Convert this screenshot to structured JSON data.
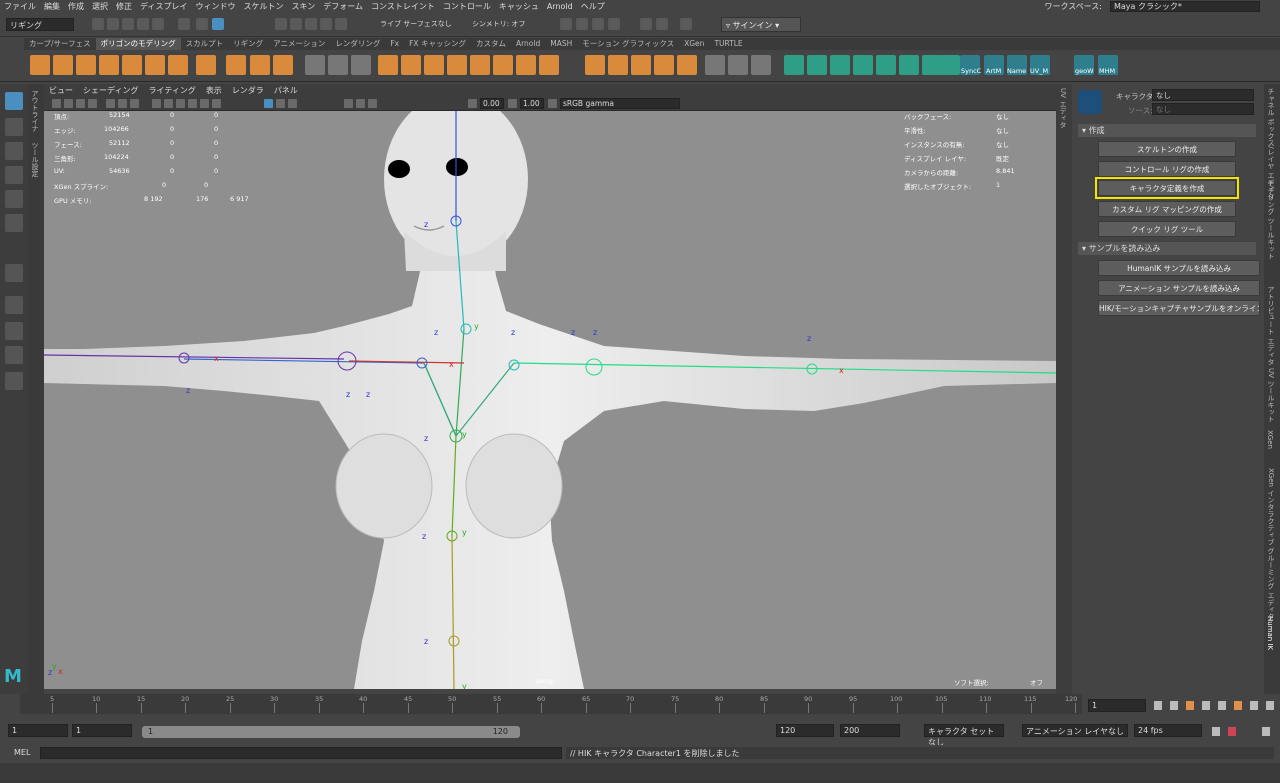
{
  "menubar": {
    "items": [
      "ファイル",
      "編集",
      "作成",
      "選択",
      "修正",
      "ディスプレイ",
      "ウィンドウ",
      "スケルトン",
      "スキン",
      "デフォーム",
      "コンストレイント",
      "コントロール",
      "キャッシュ",
      "Arnold",
      "ヘルプ"
    ],
    "workspace_label": "ワークスペース:",
    "workspace_value": "Maya クラシック*"
  },
  "statusline": {
    "mode": "リギング",
    "live_surface": "ライブ サーフェスなし",
    "symmetry": "シンメトリ: オフ",
    "signin": "サインイン"
  },
  "shelf": {
    "tabs": [
      "カーブ/サーフェス",
      "ポリゴンのモデリング",
      "スカルプト",
      "リギング",
      "アニメーション",
      "レンダリング",
      "Fx",
      "FX キャッシング",
      "カスタム",
      "Arnold",
      "MASH",
      "モーション グラフィックス",
      "XGen",
      "TURTLE"
    ],
    "active_tab": "ポリゴンのモデリング",
    "labels": [
      "SyncC",
      "ArtM",
      "Name",
      "UV_M",
      "geoW",
      "MHM"
    ]
  },
  "sidetabs_left": [
    "アウトライナ",
    "ツール設定"
  ],
  "panel": {
    "menu": [
      "ビュー",
      "シェーディング",
      "ライティング",
      "表示",
      "レンダラ",
      "パネル"
    ],
    "exposure": "0.00",
    "gamma": "1.00",
    "color_space": "sRGB gamma"
  },
  "hud_left": [
    {
      "label": "頂点:",
      "v1": "52154",
      "v2": "0",
      "v3": "0"
    },
    {
      "label": "エッジ:",
      "v1": "104266",
      "v2": "0",
      "v3": "0"
    },
    {
      "label": "フェース:",
      "v1": "52112",
      "v2": "0",
      "v3": "0"
    },
    {
      "label": "三角形:",
      "v1": "104224",
      "v2": "0",
      "v3": "0"
    },
    {
      "label": "UV:",
      "v1": "54636",
      "v2": "0",
      "v3": "0"
    },
    {
      "label": "XGen スプライン:",
      "v1": "",
      "v2": "0",
      "v3": "0"
    },
    {
      "label": "GPU メモリ:",
      "v1": "8 192",
      "v2": "176",
      "v3": "6 917"
    }
  ],
  "hud_right": [
    {
      "label": "バックフェース:",
      "value": "なし"
    },
    {
      "label": "平滑性:",
      "value": "なし"
    },
    {
      "label": "インスタンスの有無:",
      "value": "なし"
    },
    {
      "label": "ディスプレイ レイヤ:",
      "value": "既定"
    },
    {
      "label": "カメラからの距離:",
      "value": "8.841"
    },
    {
      "label": "選択したオブジェクト:",
      "value": "1"
    }
  ],
  "viewport": {
    "camera": "persp",
    "soft_select_label": "ソフト選択:",
    "soft_select_value": "オフ"
  },
  "uv_strip_label": "UV エディタ",
  "hik": {
    "character_label": "キャラクタ:",
    "character_value": "なし",
    "source_label": "ソース:",
    "source_value": "なし",
    "section_create": "作成",
    "buttons_create": [
      "スケルトンの作成",
      "コントロール リグの作成",
      "キャラクタ定義を作成",
      "カスタム リグ マッピングの作成",
      "クイック リグ ツール"
    ],
    "section_load": "サンプルを読み込み",
    "buttons_load": [
      "HumanIK サンプルを読み込み",
      "アニメーション サンプルを読み込み",
      "HIK/モーションキャプチャサンプルをオンラインで取得"
    ]
  },
  "sidetabs_right": [
    "チャネル ボックス/レイヤ エディタ",
    "モデリング ツールキット",
    "アトリビュート エディタ",
    "UV ツールキット",
    "XGen",
    "XGen インタラクティブ グルーミング エディタ",
    "Human IK"
  ],
  "timeline": {
    "ticks": [
      "5",
      "10",
      "15",
      "20",
      "25",
      "30",
      "35",
      "40",
      "45",
      "50",
      "55",
      "60",
      "65",
      "70",
      "75",
      "80",
      "85",
      "90",
      "95",
      "100",
      "105",
      "110",
      "115",
      "120"
    ],
    "current_frame": "1"
  },
  "range": {
    "start": "1",
    "start_inner": "1",
    "slider_start": "1",
    "slider_end": "120",
    "end_inner": "120",
    "end": "200",
    "character_set": "キャラクタ セットなし",
    "anim_layer": "アニメーション レイヤなし",
    "fps": "24 fps"
  },
  "cmdline": {
    "label": "MEL",
    "result": "// HIK キャラクタ Character1 を削除しました"
  }
}
